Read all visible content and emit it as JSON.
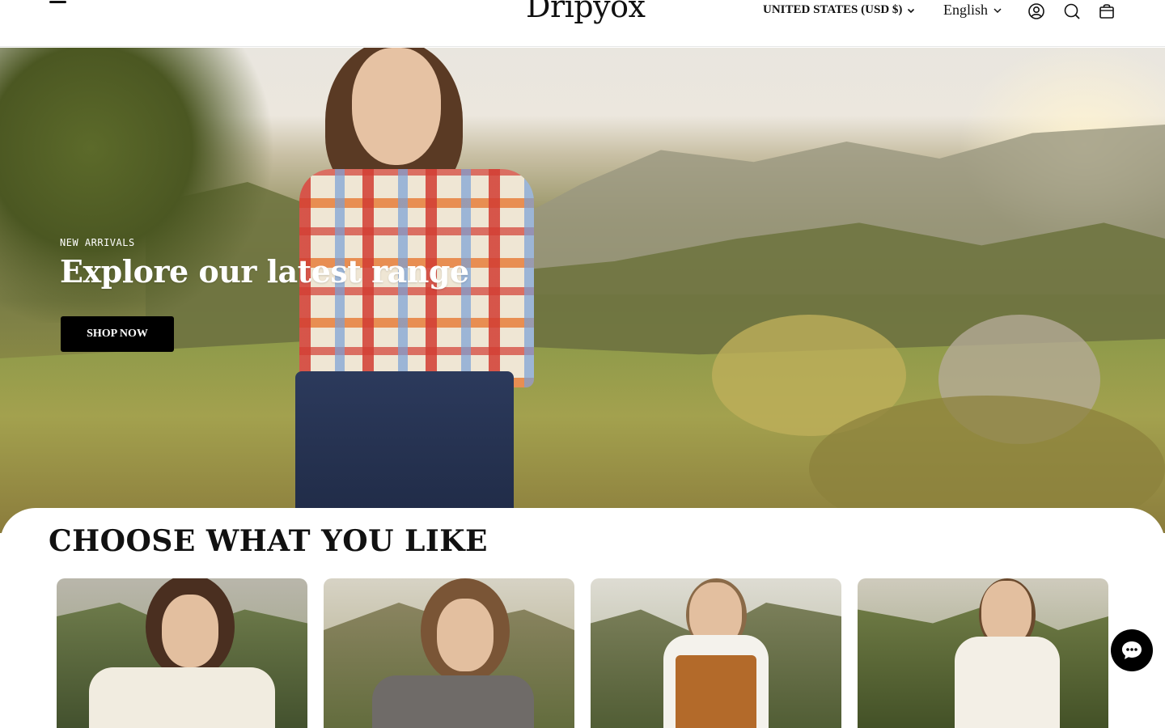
{
  "header": {
    "logo": "Dripyox",
    "country_selector": "UNITED STATES (USD $)",
    "language_selector": "English",
    "icons": [
      "menu-icon",
      "account-icon",
      "search-icon",
      "cart-icon"
    ]
  },
  "hero": {
    "eyebrow": "NEW ARRIVALS",
    "title": "Explore our latest range",
    "cta_label": "SHOP NOW"
  },
  "section": {
    "title": "CHOOSE WHAT YOU LIKE"
  },
  "colors": {
    "primary": "#000000",
    "background": "#ffffff",
    "text": "#111111"
  }
}
